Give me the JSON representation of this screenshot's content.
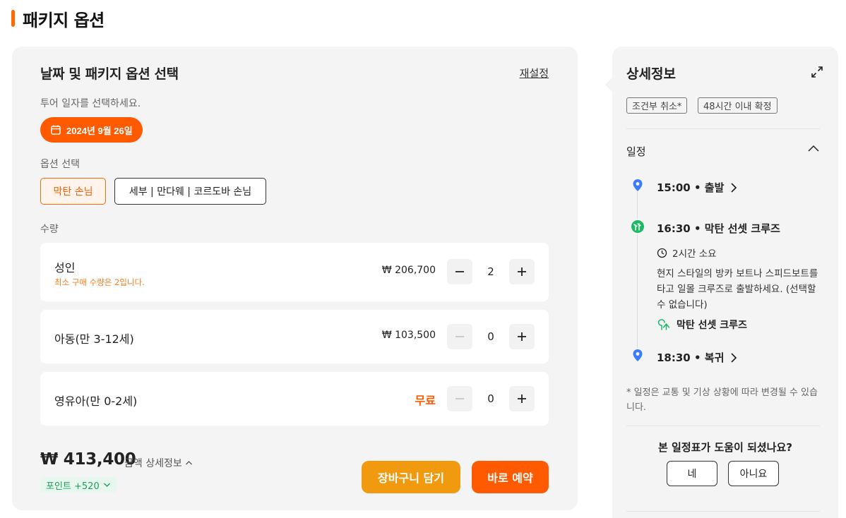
{
  "section": {
    "title": "패키지 옵션"
  },
  "panel": {
    "heading": "날짜 및 패키지 옵션 선택",
    "reset_label": "재설정",
    "date_prompt": "투어 일자를 선택하세요.",
    "date_value": "2024년 9월 26일",
    "option_label": "옵션 선택",
    "options": [
      {
        "label": "막탄 손님",
        "selected": true
      },
      {
        "label": "세부 | 만다웨 | 코르도바 손님",
        "selected": false
      }
    ],
    "qty_label": "수량",
    "rows": [
      {
        "name": "성인",
        "hint": "최소 구매 수량은 2입니다.",
        "price": "₩ 206,700",
        "qty": "2"
      },
      {
        "name": "아동(만 3-12세)",
        "price": "₩ 103,500",
        "qty": "0"
      },
      {
        "name": "영유아(만 0-2세)",
        "price": "무료",
        "qty": "0"
      }
    ],
    "total": "₩ 413,400",
    "total_detail": "금액 상세정보",
    "points": "포인트 +520",
    "cart_label": "장바구니 담기",
    "book_label": "바로 예약"
  },
  "side": {
    "title": "상세정보",
    "tags": [
      "조건부 취소*",
      "48시간 이내 확정"
    ],
    "section": "일정",
    "timeline": [
      {
        "title": "15:00 • 출발"
      },
      {
        "title": "16:30 • 막탄 선셋 크루즈",
        "duration": "2시간 소요",
        "description": "현지 스타일의 방카 보트나 스피드보트를 타고 일몰 크루즈로 출발하세요. (선택할 수 없습니다)",
        "place": "막탄 선셋 크루즈"
      },
      {
        "title": "18:30 • 복귀"
      }
    ],
    "note": "* 일정은 교통 및 기상 상황에 따라 변경될 수 있습니다.",
    "feedback_q": "본 일정표가 도움이 되셨나요?",
    "yes": "네",
    "no": "아니요"
  },
  "colors": {
    "accent": "#ff5a00",
    "cart": "#f19a10",
    "pin": "#3b7bff",
    "tree": "#1fb866"
  },
  "icons": [
    "calendar-icon",
    "minus-icon",
    "plus-icon",
    "chevron-up-icon",
    "chevron-down-icon",
    "expand-icon",
    "location-pin-icon",
    "tree-icon",
    "clock-icon",
    "chevron-right-icon"
  ]
}
